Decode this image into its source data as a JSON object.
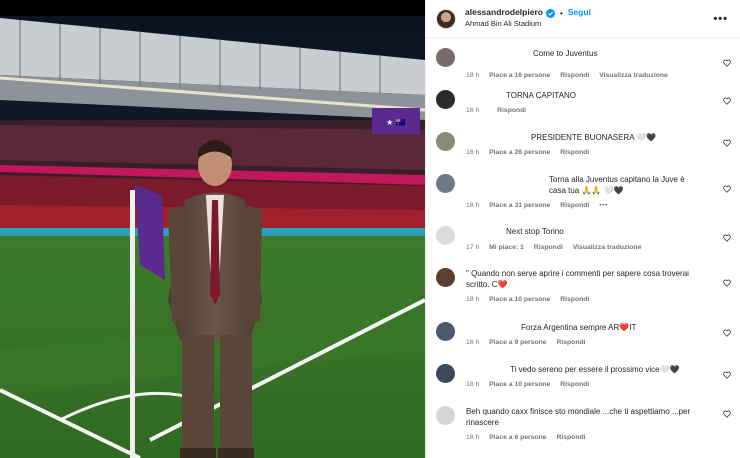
{
  "header": {
    "username": "alessandrodelpiero",
    "follow_label": "Segui",
    "separator": "•",
    "location": "Ahmad Bin Ali Stadium",
    "more_label": "•••"
  },
  "photo": {
    "board_text": "★ 🇦🇺"
  },
  "comments": [
    {
      "text": "Come to Juventus",
      "time": "18 h",
      "likes": "Piace a 16 persone",
      "reply": "Rispondi",
      "extra": "Visualizza traduzione",
      "avatar_color": "#7a6a6a"
    },
    {
      "text": "TORNA CAPITANO",
      "time": "16 h",
      "likes": "",
      "reply": "Rispondi",
      "extra": "",
      "avatar_color": "#2a2a2a"
    },
    {
      "text": "PRESIDENTE BUONASERA 🤍🖤",
      "time": "16 h",
      "likes": "Piace a 28 persone",
      "reply": "Rispondi",
      "extra": "",
      "avatar_color": "#8a8a7a"
    },
    {
      "text": "Torna alla Juventus capitano la Juve è casa tua 🙏🙏 🤍🖤",
      "time": "18 h",
      "likes": "Piace a 31 persone",
      "reply": "Rispondi",
      "extra": "•••",
      "avatar_color": "#6b7a88"
    },
    {
      "text": "Next stop Torino",
      "time": "17 h",
      "likes": "Mi piace: 1",
      "reply": "Rispondi",
      "extra": "Visualizza traduzione",
      "avatar_color": "#dcdcdc"
    },
    {
      "text": "\" Quando non serve aprire i commenti per sapere cosa troverai scritto. C❤️",
      "time": "18 h",
      "likes": "Piace a 10 persone",
      "reply": "Rispondi",
      "extra": "",
      "avatar_color": "#5a4030"
    },
    {
      "text": "Forza Argentina sempre AR❤️IT",
      "time": "16 h",
      "likes": "Piace a 9 persone",
      "reply": "Rispondi",
      "extra": "",
      "avatar_color": "#4a5a6a"
    },
    {
      "text": "Ti vedo sereno per essere il prossimo vice🤍🖤",
      "time": "18 h",
      "likes": "Piace a 10 persone",
      "reply": "Rispondi",
      "extra": "",
      "avatar_color": "#3a4a5a"
    },
    {
      "text": "Beh quando caxx finisce sto mondiale ...che ti aspettiamo ...per rinascere",
      "time": "18 h",
      "likes": "Piace a 6 persone",
      "reply": "Rispondi",
      "extra": "",
      "avatar_color": "#d5d5d5"
    }
  ]
}
